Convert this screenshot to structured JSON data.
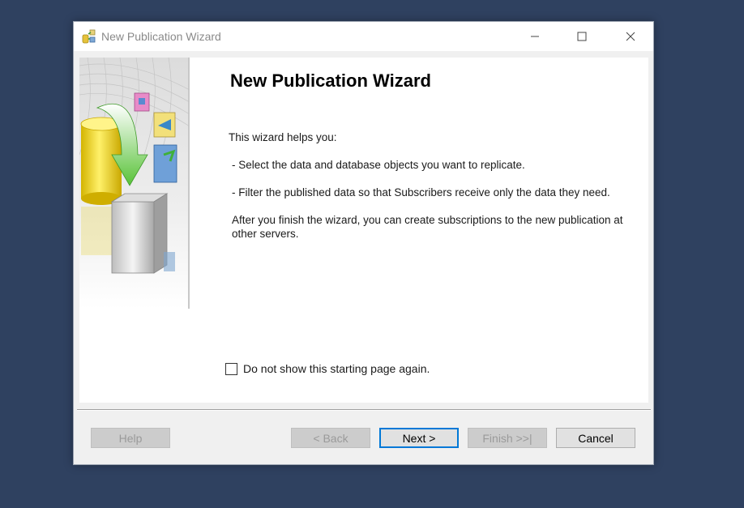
{
  "window": {
    "title": "New Publication Wizard"
  },
  "page": {
    "heading": "New Publication Wizard",
    "intro": "This wizard helps you:",
    "bullet1": " - Select the data and database objects you want to replicate.",
    "bullet2": " - Filter the published data so that Subscribers receive only the data they need.",
    "after": " After you finish the wizard, you can create subscriptions to the new publication at other servers.",
    "checkbox_label": "Do not show this starting page again.",
    "checkbox_checked": false
  },
  "buttons": {
    "help": "Help",
    "back": "< Back",
    "next": "Next >",
    "finish": "Finish >>|",
    "cancel": "Cancel"
  },
  "icons": {
    "title": "publication-wizard-icon",
    "minimize": "minimize-icon",
    "maximize": "maximize-icon",
    "close": "close-icon",
    "side": "replication-illustration"
  },
  "colors": {
    "accent": "#0078d7",
    "desktop": "#2f4160"
  }
}
